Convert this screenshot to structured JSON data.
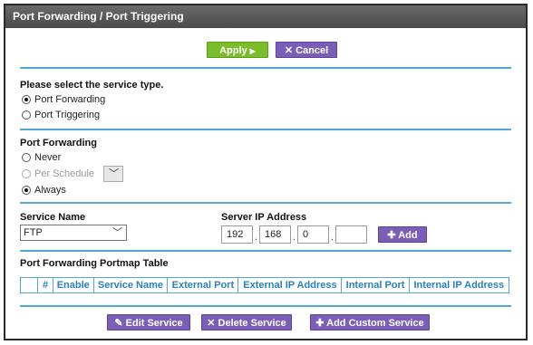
{
  "title": "Port Forwarding / Port Triggering",
  "toolbar": {
    "apply_label": "Apply",
    "cancel_label": "Cancel"
  },
  "service_type": {
    "heading": "Please select the service type.",
    "options": [
      "Port Forwarding",
      "Port Triggering"
    ],
    "selected": "Port Forwarding"
  },
  "port_forwarding": {
    "heading": "Port Forwarding",
    "options": [
      "Never",
      "Per Schedule",
      "Always"
    ],
    "selected": "Always"
  },
  "service": {
    "name_label": "Service Name",
    "name_value": "FTP",
    "ip_label": "Server IP Address",
    "ip": [
      "192",
      "168",
      "0",
      ""
    ],
    "add_label": "Add"
  },
  "table": {
    "title": "Port Forwarding Portmap Table",
    "headers": [
      "",
      "#",
      "Enable",
      "Service Name",
      "External Port",
      "External IP Address",
      "Internal Port",
      "Internal IP Address"
    ]
  },
  "actions": {
    "edit_label": "Edit Service",
    "delete_label": "Delete Service",
    "add_custom_label": "Add Custom Service"
  },
  "colors": {
    "accent": "#54a8d6",
    "apply": "#7cbd2e",
    "action": "#7b5fb7"
  }
}
